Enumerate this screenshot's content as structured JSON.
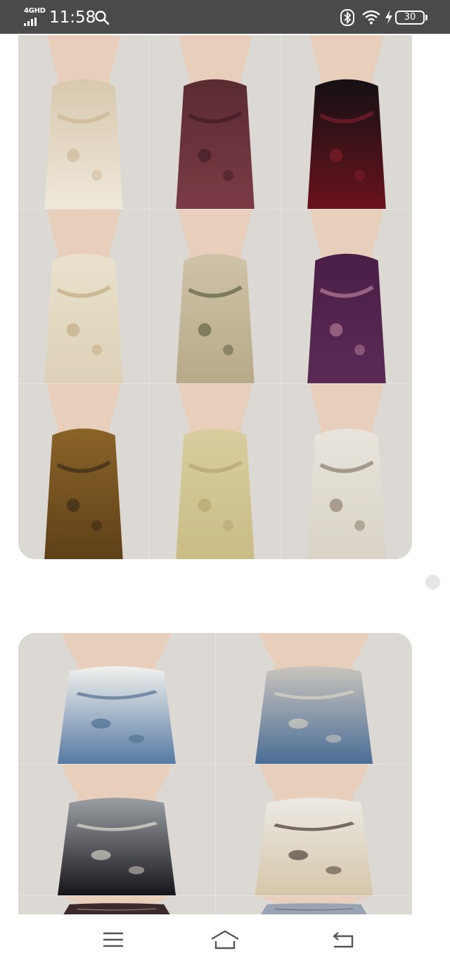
{
  "status_bar": {
    "network": "4GHD",
    "time": "11:58",
    "battery": "30",
    "icons": [
      "search-icon",
      "bluetooth-icon",
      "wifi-icon",
      "charging-bolt-icon",
      "battery-icon"
    ]
  },
  "feed": {
    "card_1": {
      "images": [
        {
          "name": "white-lace-halter-dress",
          "top": "#d8c8ae",
          "bottom": "#efe8da",
          "accent": "#c9b28e"
        },
        {
          "name": "burgundy-choker-dress",
          "top": "#5a2b32",
          "bottom": "#7b3b45",
          "accent": "#3a1820"
        },
        {
          "name": "black-velvet-rose-dress",
          "top": "#141114",
          "bottom": "#6a121d",
          "accent": "#8c2030"
        },
        {
          "name": "cream-pearl-corset-dress",
          "top": "#e9e1cc",
          "bottom": "#ddd2b8",
          "accent": "#bca276"
        },
        {
          "name": "floral-print-slip-dress",
          "top": "#cfc3a8",
          "bottom": "#b7a989",
          "accent": "#4b5032"
        },
        {
          "name": "purple-floral-satin-dress",
          "top": "#4a1e46",
          "bottom": "#5b2b55",
          "accent": "#c88ea6"
        },
        {
          "name": "gold-brocade-halter-dress",
          "top": "#8a6328",
          "bottom": "#5e4018",
          "accent": "#2e2415"
        },
        {
          "name": "champagne-lace-slip-dress",
          "top": "#d8cd9f",
          "bottom": "#c9bc85",
          "accent": "#b0a06a"
        },
        {
          "name": "white-plum-blossom-qipao",
          "top": "#e8e4dc",
          "bottom": "#d9d3c6",
          "accent": "#7a6a5a"
        }
      ]
    },
    "card_2": {
      "images": [
        {
          "name": "denim-pinafore-white-blouse",
          "top": "#f2f1ee",
          "bottom": "#5579a2",
          "accent": "#3d5f86"
        },
        {
          "name": "denim-pinafore-lace-blouse",
          "top": "#c9c4bd",
          "bottom": "#4a6d96",
          "accent": "#e7dcc8"
        },
        {
          "name": "black-velvet-bow-cardigan",
          "top": "#9b9fa4",
          "bottom": "#16151a",
          "accent": "#f3eee2"
        },
        {
          "name": "knit-vest-white-blouse",
          "top": "#ece9e4",
          "bottom": "#d5c6a9",
          "accent": "#2a1c16"
        },
        {
          "name": "partial-image-left",
          "top": "#3a2a2a",
          "bottom": "#3a2a2a",
          "accent": "#e8d8d0"
        },
        {
          "name": "partial-image-right",
          "top": "#9aa3b3",
          "bottom": "#9aa3b3",
          "accent": "#3a3a3a"
        }
      ]
    }
  },
  "nav_bar": {
    "buttons": [
      "menu-icon",
      "home-icon",
      "back-icon"
    ]
  }
}
